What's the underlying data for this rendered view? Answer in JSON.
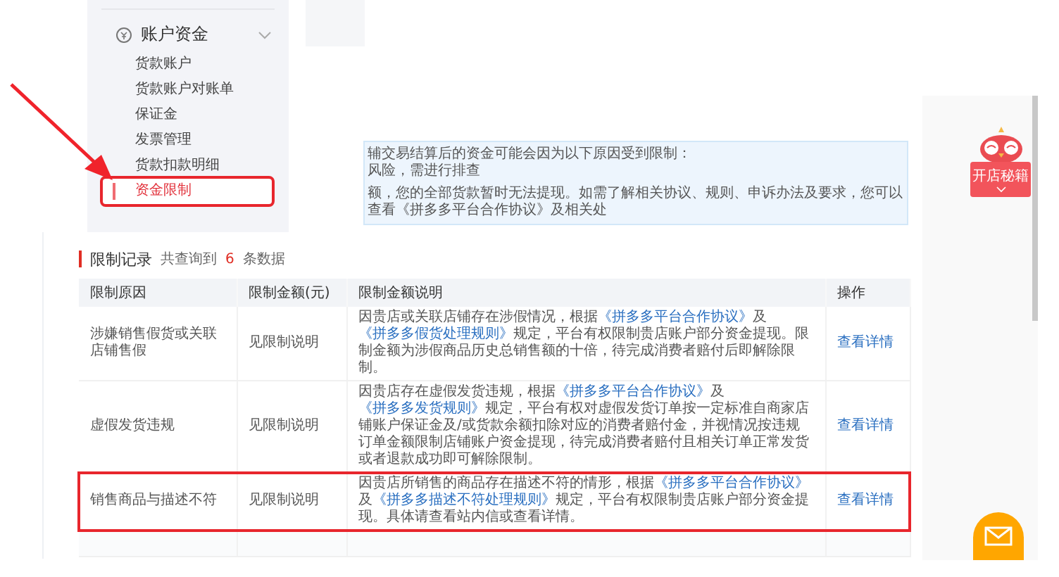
{
  "sidebar": {
    "section": {
      "title": "账户资金",
      "expanded": true
    },
    "items": [
      {
        "label": "货款账户",
        "selected": false,
        "highlighted": false
      },
      {
        "label": "货款账户对账单",
        "selected": false,
        "highlighted": false
      },
      {
        "label": "保证金",
        "selected": false,
        "highlighted": false
      },
      {
        "label": "发票管理",
        "selected": false,
        "highlighted": false
      },
      {
        "label": "货款扣款明细",
        "selected": false,
        "highlighted": false
      },
      {
        "label": "资金限制",
        "selected": true,
        "highlighted": true
      }
    ]
  },
  "notice": {
    "lines": [
      "辅交易结算后的资金可能会因为以下原因受到限制：",
      "风险，需进行排查",
      "额，您的全部货款暂时无法提现。如需了解相关协议、规则、申诉办法及要求，您可以查看《拼多多平台合作协议》及相关处"
    ]
  },
  "records": {
    "title": "限制记录",
    "count_prefix": "共查询到",
    "count": "6",
    "count_suffix": "条数据",
    "columns": [
      "限制原因",
      "限制金额(元)",
      "限制金额说明",
      "操作"
    ],
    "rows": [
      {
        "reason": "涉嫌销售假货或关联店铺售假",
        "amount": "见限制说明",
        "action": "查看详情",
        "highlighted": false,
        "description": [
          {
            "kind": "text",
            "text": "因贵店或关联店铺存在涉假情况，根据"
          },
          {
            "kind": "link",
            "text": "《拼多多平台合作协议》"
          },
          {
            "kind": "text",
            "text": "及"
          },
          {
            "kind": "link",
            "text": "《拼多多假货处理规则》"
          },
          {
            "kind": "text",
            "text": "规定，平台有权限制贵店账户部分资金提现。限制金额为涉假商品历史总销售额的十倍，待完成消费者赔付后即解除限制。"
          }
        ]
      },
      {
        "reason": "虚假发货违规",
        "amount": "见限制说明",
        "action": "查看详情",
        "highlighted": false,
        "description": [
          {
            "kind": "text",
            "text": "因贵店存在虚假发货违规，根据"
          },
          {
            "kind": "link",
            "text": "《拼多多平台合作协议》"
          },
          {
            "kind": "text",
            "text": "及"
          },
          {
            "kind": "link",
            "text": "《拼多多发货规则》"
          },
          {
            "kind": "text",
            "text": "规定，平台有权对虚假发货订单按一定标准自商家店铺账户保证金及/或货款余额扣除对应的消费者赔付金，并视情况按违规订单金额限制店铺账户资金提现，待完成消费者赔付且相关订单正常发货或者退款成功即可解除限制。"
          }
        ]
      },
      {
        "reason": "销售商品与描述不符",
        "amount": "见限制说明",
        "action": "查看详情",
        "highlighted": true,
        "description": [
          {
            "kind": "text",
            "text": "因贵店所销售的商品存在描述不符的情形，根据"
          },
          {
            "kind": "link",
            "text": "《拼多多平台合作协议》"
          },
          {
            "kind": "text",
            "text": "及"
          },
          {
            "kind": "link",
            "text": "《拼多多描述不符处理规则》"
          },
          {
            "kind": "text",
            "text": "规定，平台有权限制贵店账户部分资金提现。具体请查看站内信或查看详情。"
          }
        ]
      }
    ]
  },
  "help_badge": {
    "label": "开店秘籍"
  }
}
